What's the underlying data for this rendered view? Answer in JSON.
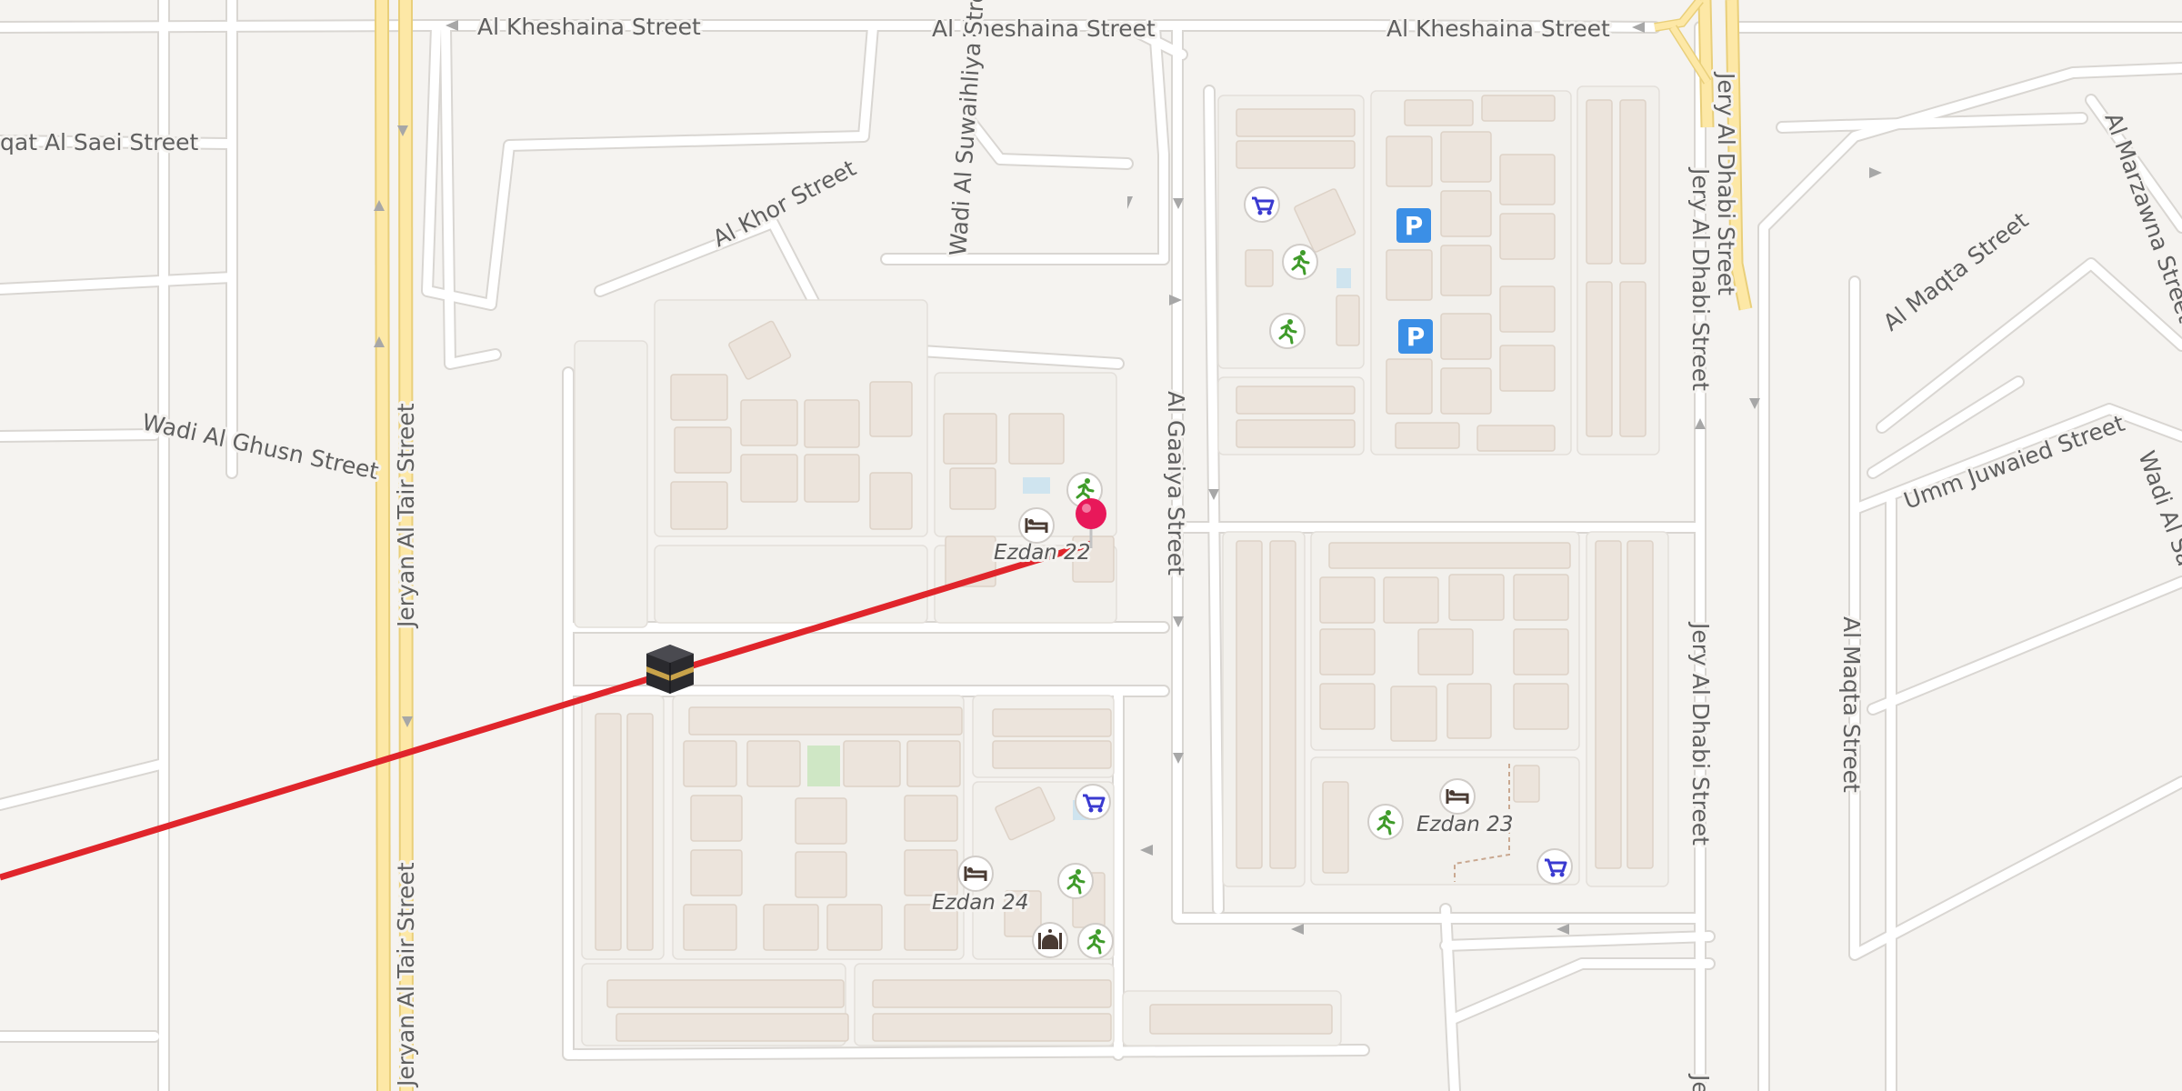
{
  "streets": {
    "al_kheshaina_1": "Al Kheshaina Street",
    "al_kheshaina_2": "Al Kheshaina Street",
    "al_kheshaina_3": "Al Kheshaina Street",
    "seqat_al_saei": "qat Al Saei Street",
    "al_suwaihliya": "Wadi Al Suwaihliya Street",
    "al_khor": "Al Khor Street",
    "wadi_al_ghusn": "Wadi Al Ghusn Street",
    "jeryan_al_tair_1": "Jeryan Al Tair Street",
    "jeryan_al_tair_2": "Jeryan Al Tair Street",
    "al_gaaiya": "Al Gaaiya Street",
    "jery_al_dhabi_1": "Jery Al Dhabi Street",
    "jery_al_dhabi_2": "Jery Al Dhabi Street",
    "jery_al_dhabi_3": "Jery Al Dhabi Street",
    "jery_al_dhabi_4": "Je",
    "al_maqta_1": "Al Maqta Street",
    "al_maqta_2": "Al Maqta Street",
    "al_marzawna": "Al Marzawna Street",
    "umm_juwaied": "Umm Juwaied Street",
    "wadi_al_sa": "Wadi Al Sa"
  },
  "places": {
    "ezdan_22": "Ezdan 22",
    "ezdan_23": "Ezdan 23",
    "ezdan_24": "Ezdan 24"
  },
  "poi_icons": [
    "shopping-cart-icon",
    "parking-icon",
    "fitness-icon",
    "hotel-icon",
    "mosque-icon",
    "kaaba-icon",
    "location-pin-icon"
  ],
  "parking_symbol": "P",
  "colors": {
    "background": "#f5f3f0",
    "road": "#ffffff",
    "major_road": "#fde8a6",
    "qibla_line": "#e0252b",
    "pin": "#e8185a",
    "parking": "#3b8fe6",
    "shopping": "#3a3ad0",
    "fitness": "#3f9b2a",
    "hotel": "#4a3b33"
  }
}
